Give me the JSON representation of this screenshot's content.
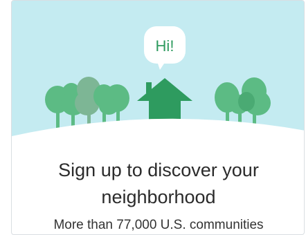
{
  "bubble": {
    "text": "Hi!"
  },
  "headline": {
    "line1": "Sign up to discover your",
    "line2": "neighborhood"
  },
  "subtext": "More than 77,000 U.S. communities",
  "colors": {
    "sky": "#c4ebf1",
    "ground": "#ffffff",
    "tree_green": "#5cbb84",
    "tree_green_dark": "#4aaa73",
    "tree_muted": "#7db695",
    "house_green": "#2e9b5f",
    "bubble_text": "#2e9b5f"
  }
}
